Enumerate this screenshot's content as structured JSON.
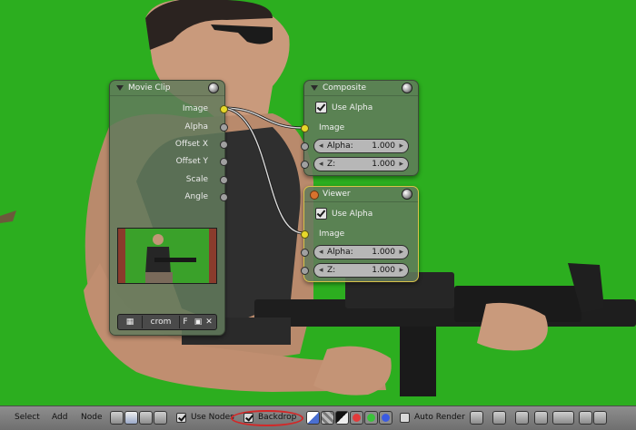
{
  "toolbar": {
    "menus": [
      "Select",
      "Add",
      "Node"
    ],
    "use_nodes_label": "Use Nodes",
    "backdrop_label": "Backdrop",
    "auto_render_label": "Auto Render"
  },
  "nodes": {
    "movie_clip": {
      "title": "Movie Clip",
      "outputs": [
        "Image",
        "Alpha",
        "Offset X",
        "Offset Y",
        "Scale",
        "Angle"
      ],
      "clip_name": "crom",
      "fake_user": "F"
    },
    "composite": {
      "title": "Composite",
      "use_alpha_label": "Use Alpha",
      "image_label": "Image",
      "alpha_label": "Alpha:",
      "alpha_value": "1.000",
      "z_label": "Z:",
      "z_value": "1.000"
    },
    "viewer": {
      "title": "Viewer",
      "use_alpha_label": "Use Alpha",
      "image_label": "Image",
      "alpha_label": "Alpha:",
      "alpha_value": "1.000",
      "z_label": "Z:",
      "z_value": "1.000"
    }
  },
  "colors": {
    "backdrop_green": "#2cae1f",
    "socket_image": "#e6d82a",
    "socket_value": "#a0a0a0",
    "highlight": "#d22828"
  }
}
